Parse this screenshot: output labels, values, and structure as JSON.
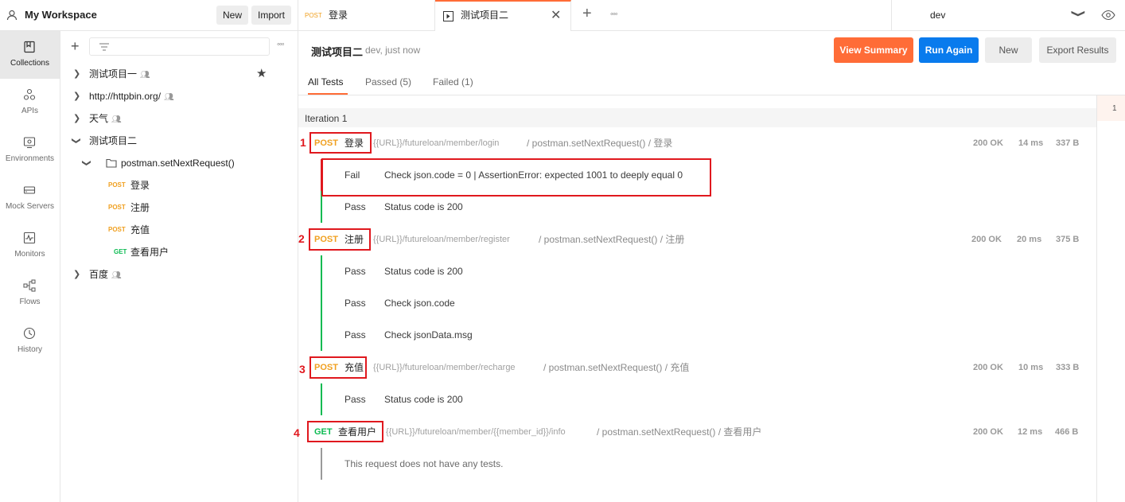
{
  "workspace": {
    "name": "My Workspace",
    "new_label": "New",
    "import_label": "Import"
  },
  "nav": [
    {
      "label": "Collections",
      "icon": "collections-icon"
    },
    {
      "label": "APIs",
      "icon": "apis-icon"
    },
    {
      "label": "Environments",
      "icon": "environments-icon"
    },
    {
      "label": "Mock Servers",
      "icon": "mock-servers-icon"
    },
    {
      "label": "Monitors",
      "icon": "monitors-icon"
    },
    {
      "label": "Flows",
      "icon": "flows-icon"
    },
    {
      "label": "History",
      "icon": "history-icon"
    }
  ],
  "tree": {
    "items": [
      {
        "label": "测试项目一"
      },
      {
        "label": "http://httpbin.org/"
      },
      {
        "label": "天气"
      },
      {
        "label": "测试项目二"
      },
      {
        "label": "postman.setNextRequest()"
      },
      {
        "method": "POST",
        "label": "登录"
      },
      {
        "method": "POST",
        "label": "注册"
      },
      {
        "method": "POST",
        "label": "充值"
      },
      {
        "method": "GET",
        "label": "查看用户"
      },
      {
        "label": "百度"
      }
    ]
  },
  "tabs": [
    {
      "method": "POST",
      "label": "登录"
    },
    {
      "label": "测试项目二"
    }
  ],
  "env": {
    "selected": "dev"
  },
  "runner": {
    "title": "测试项目二",
    "meta": "dev, just now",
    "view_summary": "View Summary",
    "run_again": "Run Again",
    "new": "New",
    "export": "Export Results",
    "subtabs": [
      "All Tests",
      "Passed (5)",
      "Failed (1)"
    ],
    "iteration": "Iteration 1",
    "iteration_counter": "1"
  },
  "requests": [
    {
      "num": "1",
      "method": "POST",
      "name": "登录",
      "url": "{{URL}}/futureloan/member/login",
      "path": "/ postman.setNextRequest() / 登录",
      "status": "200 OK",
      "time": "14 ms",
      "size": "337 B",
      "tests": [
        {
          "result": "Fail",
          "name": "Check json.code = 0 | AssertionError: expected 1001 to deeply equal 0"
        },
        {
          "result": "Pass",
          "name": "Status code is 200"
        }
      ]
    },
    {
      "num": "2",
      "method": "POST",
      "name": "注册",
      "url": "{{URL}}/futureloan/member/register",
      "path": "/ postman.setNextRequest() / 注册",
      "status": "200 OK",
      "time": "20 ms",
      "size": "375 B",
      "tests": [
        {
          "result": "Pass",
          "name": "Status code is 200"
        },
        {
          "result": "Pass",
          "name": "Check json.code"
        },
        {
          "result": "Pass",
          "name": "Check jsonData.msg"
        }
      ]
    },
    {
      "num": "3",
      "method": "POST",
      "name": "充值",
      "url": "{{URL}}/futureloan/member/recharge",
      "path": "/ postman.setNextRequest() / 充值",
      "status": "200 OK",
      "time": "10 ms",
      "size": "333 B",
      "tests": [
        {
          "result": "Pass",
          "name": "Status code is 200"
        }
      ]
    },
    {
      "num": "4",
      "method": "GET",
      "name": "查看用户",
      "url": "{{URL}}/futureloan/member/{{member_id}}/info",
      "path": "/ postman.setNextRequest() / 查看用户",
      "status": "200 OK",
      "time": "12 ms",
      "size": "466 B",
      "tests": [],
      "no_tests": "This request does not have any tests."
    }
  ],
  "colors": {
    "orange": "#ff6c37",
    "blue": "#097bed",
    "post": "#f0a020",
    "get": "#0cbb52",
    "fail": "#e0181e",
    "pass": "#0cbb52"
  }
}
